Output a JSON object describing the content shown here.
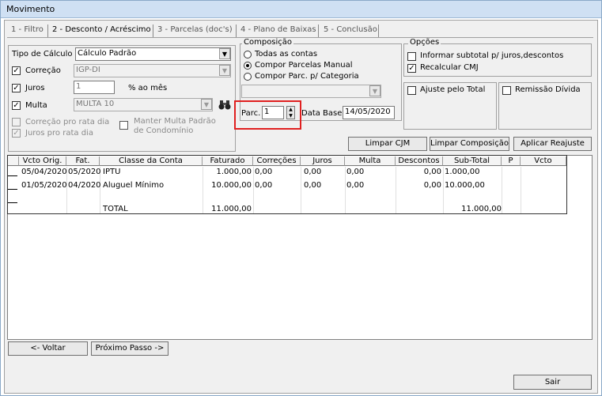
{
  "window": {
    "title": "Movimento"
  },
  "tabs": [
    {
      "label": "1 - Filtro"
    },
    {
      "label": "2 - Desconto / Acréscimo"
    },
    {
      "label": "3 - Parcelas (doc's)"
    },
    {
      "label": "4 - Plano de Baixas"
    },
    {
      "label": "5 - Conclusão"
    }
  ],
  "calc": {
    "tipo_label": "Tipo de Cálculo",
    "tipo_value": "Cálculo Padrão",
    "correcao_label": "Correção",
    "correcao_value": "IGP-DI",
    "juros_label": "Juros",
    "juros_value": "1",
    "juros_unit": "% ao mês",
    "multa_label": "Multa",
    "multa_value": "MULTA 10",
    "correcao_rata": "Correção pro rata dia",
    "juros_rata": "Juros pro rata dia",
    "manter_multa": "Manter Multa Padrão de Condomínio"
  },
  "composicao": {
    "title": "Composição",
    "options": [
      "Todas as contas",
      "Compor Parcelas Manual",
      "Compor Parc. p/ Categoria"
    ],
    "selected": 1,
    "parc_label": "Parc.",
    "parc_value": "1",
    "data_base_label": "Data Base",
    "data_base_value": "14/05/2020"
  },
  "opcoes": {
    "title": "Opções",
    "informar": "Informar subtotal p/ juros,descontos",
    "recalcular": "Recalcular CMJ",
    "ajuste": "Ajuste pelo Total",
    "remissao": "Remissão Dívida"
  },
  "buttons": {
    "limpar_cjm": "Limpar CJM",
    "limpar_comp": "Limpar Composição",
    "aplicar": "Aplicar Reajuste",
    "voltar": "<- Voltar",
    "proximo": "Próximo Passo ->",
    "sair": "Sair"
  },
  "table": {
    "columns": [
      "Vcto Orig.",
      "Fat.",
      "Classe da Conta",
      "Faturado",
      "Correções",
      "Juros",
      "Multa",
      "Descontos",
      "Sub-Total",
      "P",
      "Vcto"
    ],
    "rows": [
      [
        "05/04/2020",
        "05/2020",
        "IPTU",
        "1.000,00",
        "0,00",
        "0,00",
        "0,00",
        "0,00",
        "1.000,00",
        "",
        ""
      ],
      [
        "01/05/2020",
        "04/2020",
        "Aluguel Mínimo",
        "10.000,00",
        "0,00",
        "0,00",
        "0,00",
        "0,00",
        "10.000,00",
        "",
        ""
      ]
    ],
    "total_label": "TOTAL",
    "total_faturado": "11.000,00",
    "total_subtotal": "11.000,00"
  }
}
